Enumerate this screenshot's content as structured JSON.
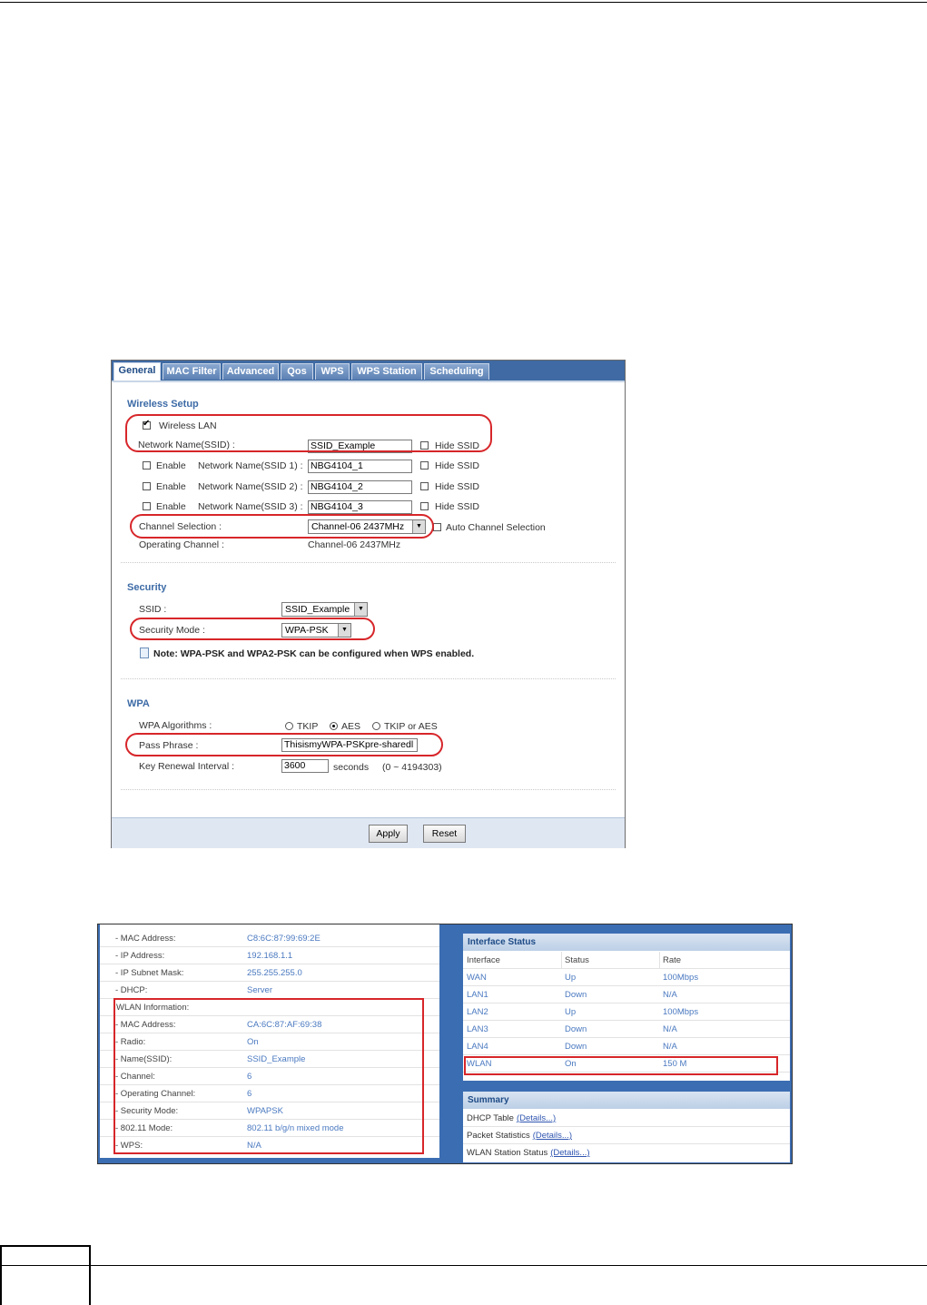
{
  "wireless": {
    "tabs": [
      "General",
      "MAC Filter",
      "Advanced",
      "Qos",
      "WPS",
      "WPS Station",
      "Scheduling"
    ],
    "setup": {
      "title": "Wireless Setup",
      "wlan_label": "Wireless LAN",
      "wlan_enabled": true,
      "ssid_label": "Network Name(SSID) :",
      "ssid_value": "SSID_Example",
      "hide_ssid": "Hide SSID",
      "enable": "Enable",
      "ssid1_label": "Network Name(SSID 1) :",
      "ssid1_value": "NBG4104_1",
      "ssid2_label": "Network Name(SSID 2) :",
      "ssid2_value": "NBG4104_2",
      "ssid3_label": "Network Name(SSID 3) :",
      "ssid3_value": "NBG4104_3",
      "channel_label": "Channel Selection :",
      "channel_value": "Channel-06 2437MHz",
      "auto_channel": "Auto Channel Selection",
      "op_channel_label": "Operating Channel :",
      "op_channel_value": "Channel-06 2437MHz"
    },
    "security": {
      "title": "Security",
      "ssid_label": "SSID :",
      "ssid_value": "SSID_Example",
      "mode_label": "Security Mode :",
      "mode_value": "WPA-PSK",
      "note": "Note: WPA-PSK and WPA2-PSK can be configured when WPS enabled."
    },
    "wpa": {
      "title": "WPA",
      "alg_label": "WPA Algorithms :",
      "tkip": "TKIP",
      "aes": "AES",
      "tkip_aes": "TKIP or AES",
      "selected_alg": "AES",
      "pass_label": "Pass Phrase :",
      "pass_value": "ThisismyWPA-PSKpre-sharedl",
      "renew_label": "Key Renewal Interval :",
      "renew_value": "3600",
      "renew_unit": "seconds",
      "renew_range": "(0 ~ 4194303)"
    },
    "buttons": {
      "apply": "Apply",
      "reset": "Reset"
    }
  },
  "status": {
    "lan_rows": [
      {
        "key": "- MAC Address:",
        "value": "C8:6C:87:99:69:2E"
      },
      {
        "key": "- IP Address:",
        "value": "192.168.1.1"
      },
      {
        "key": "- IP Subnet Mask:",
        "value": "255.255.255.0"
      },
      {
        "key": "- DHCP:",
        "value": "Server"
      }
    ],
    "wlan_header": "WLAN Information:",
    "wlan_rows": [
      {
        "key": "- MAC Address:",
        "value": "CA:6C:87:AF:69:38"
      },
      {
        "key": "- Radio:",
        "value": "On"
      },
      {
        "key": "- Name(SSID):",
        "value": "SSID_Example"
      },
      {
        "key": "- Channel:",
        "value": "6"
      },
      {
        "key": "- Operating Channel:",
        "value": "6"
      },
      {
        "key": "- Security Mode:",
        "value": "WPAPSK"
      },
      {
        "key": "- 802.11 Mode:",
        "value": "802.11 b/g/n mixed mode"
      },
      {
        "key": "- WPS:",
        "value": "N/A"
      }
    ],
    "interface_title": "Interface Status",
    "interface_headers": [
      "Interface",
      "Status",
      "Rate"
    ],
    "interfaces": [
      {
        "name": "WAN",
        "status": "Up",
        "rate": "100Mbps"
      },
      {
        "name": "LAN1",
        "status": "Down",
        "rate": "N/A"
      },
      {
        "name": "LAN2",
        "status": "Up",
        "rate": "100Mbps"
      },
      {
        "name": "LAN3",
        "status": "Down",
        "rate": "N/A"
      },
      {
        "name": "LAN4",
        "status": "Down",
        "rate": "N/A"
      },
      {
        "name": "WLAN",
        "status": "On",
        "rate": "150 M"
      }
    ],
    "summary_title": "Summary",
    "summary_rows": [
      {
        "label": "DHCP Table",
        "link": "(Details...)"
      },
      {
        "label": "Packet Statistics",
        "link": "(Details...)"
      },
      {
        "label": "WLAN Station Status",
        "link": "(Details...)"
      }
    ]
  }
}
